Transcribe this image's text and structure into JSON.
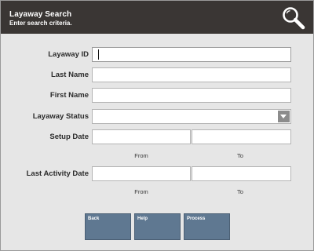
{
  "header": {
    "title": "Layaway Search",
    "subtitle": "Enter search criteria.",
    "search_icon": "magnifier-icon"
  },
  "form": {
    "layaway_id": {
      "label": "Layaway ID",
      "value": ""
    },
    "last_name": {
      "label": "Last Name",
      "value": ""
    },
    "first_name": {
      "label": "First Name",
      "value": ""
    },
    "layaway_status": {
      "label": "Layaway Status",
      "value": ""
    },
    "setup_date": {
      "label": "Setup Date",
      "from_label": "From",
      "to_label": "To",
      "from_value": "",
      "to_value": ""
    },
    "last_activity_date": {
      "label": "Last Activity Date",
      "from_label": "From",
      "to_label": "To",
      "from_value": "",
      "to_value": ""
    }
  },
  "buttons": {
    "back": "Back",
    "help": "Help",
    "process": "Process"
  },
  "colors": {
    "header_bg": "#3a3634",
    "button_bg": "#5f7891",
    "panel_bg": "#e6e6e6"
  }
}
